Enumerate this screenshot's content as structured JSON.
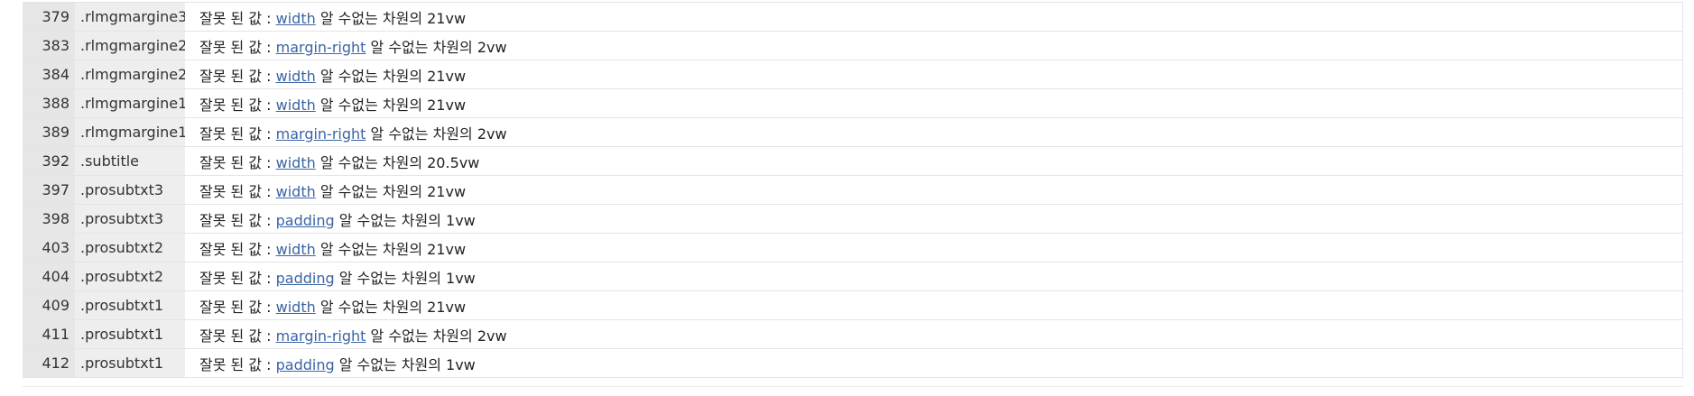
{
  "table": {
    "rows": [
      {
        "line": "379",
        "context": ".rlmgmargine3",
        "prefix": "잘못 된 값 :",
        "property": "width",
        "suffix": "알 수없는 차원의 21vw"
      },
      {
        "line": "383",
        "context": ".rlmgmargine2",
        "prefix": "잘못 된 값 :",
        "property": "margin-right",
        "suffix": "알 수없는 차원의 2vw"
      },
      {
        "line": "384",
        "context": ".rlmgmargine2",
        "prefix": "잘못 된 값 :",
        "property": "width",
        "suffix": "알 수없는 차원의 21vw"
      },
      {
        "line": "388",
        "context": ".rlmgmargine1",
        "prefix": "잘못 된 값 :",
        "property": "width",
        "suffix": "알 수없는 차원의 21vw"
      },
      {
        "line": "389",
        "context": ".rlmgmargine1",
        "prefix": "잘못 된 값 :",
        "property": "margin-right",
        "suffix": "알 수없는 차원의 2vw"
      },
      {
        "line": "392",
        "context": ".subtitle",
        "prefix": "잘못 된 값 :",
        "property": "width",
        "suffix": "알 수없는 차원의 20.5vw"
      },
      {
        "line": "397",
        "context": ".prosubtxt3",
        "prefix": "잘못 된 값 :",
        "property": "width",
        "suffix": "알 수없는 차원의 21vw"
      },
      {
        "line": "398",
        "context": ".prosubtxt3",
        "prefix": "잘못 된 값 :",
        "property": "padding",
        "suffix": "알 수없는 차원의 1vw"
      },
      {
        "line": "403",
        "context": ".prosubtxt2",
        "prefix": "잘못 된 값 :",
        "property": "width",
        "suffix": "알 수없는 차원의 21vw"
      },
      {
        "line": "404",
        "context": ".prosubtxt2",
        "prefix": "잘못 된 값 :",
        "property": "padding",
        "suffix": "알 수없는 차원의 1vw"
      },
      {
        "line": "409",
        "context": ".prosubtxt1",
        "prefix": "잘못 된 값 :",
        "property": "width",
        "suffix": "알 수없는 차원의 21vw"
      },
      {
        "line": "411",
        "context": ".prosubtxt1",
        "prefix": "잘못 된 값 :",
        "property": "margin-right",
        "suffix": "알 수없는 차원의 2vw"
      },
      {
        "line": "412",
        "context": ".prosubtxt1",
        "prefix": "잘못 된 값 :",
        "property": "padding",
        "suffix": "알 수없는 차원의 1vw"
      }
    ]
  },
  "colors": {
    "link": "#3a64a5",
    "line_cell_bg": "#e6e6e6",
    "context_cell_bg": "#eeeeee"
  }
}
